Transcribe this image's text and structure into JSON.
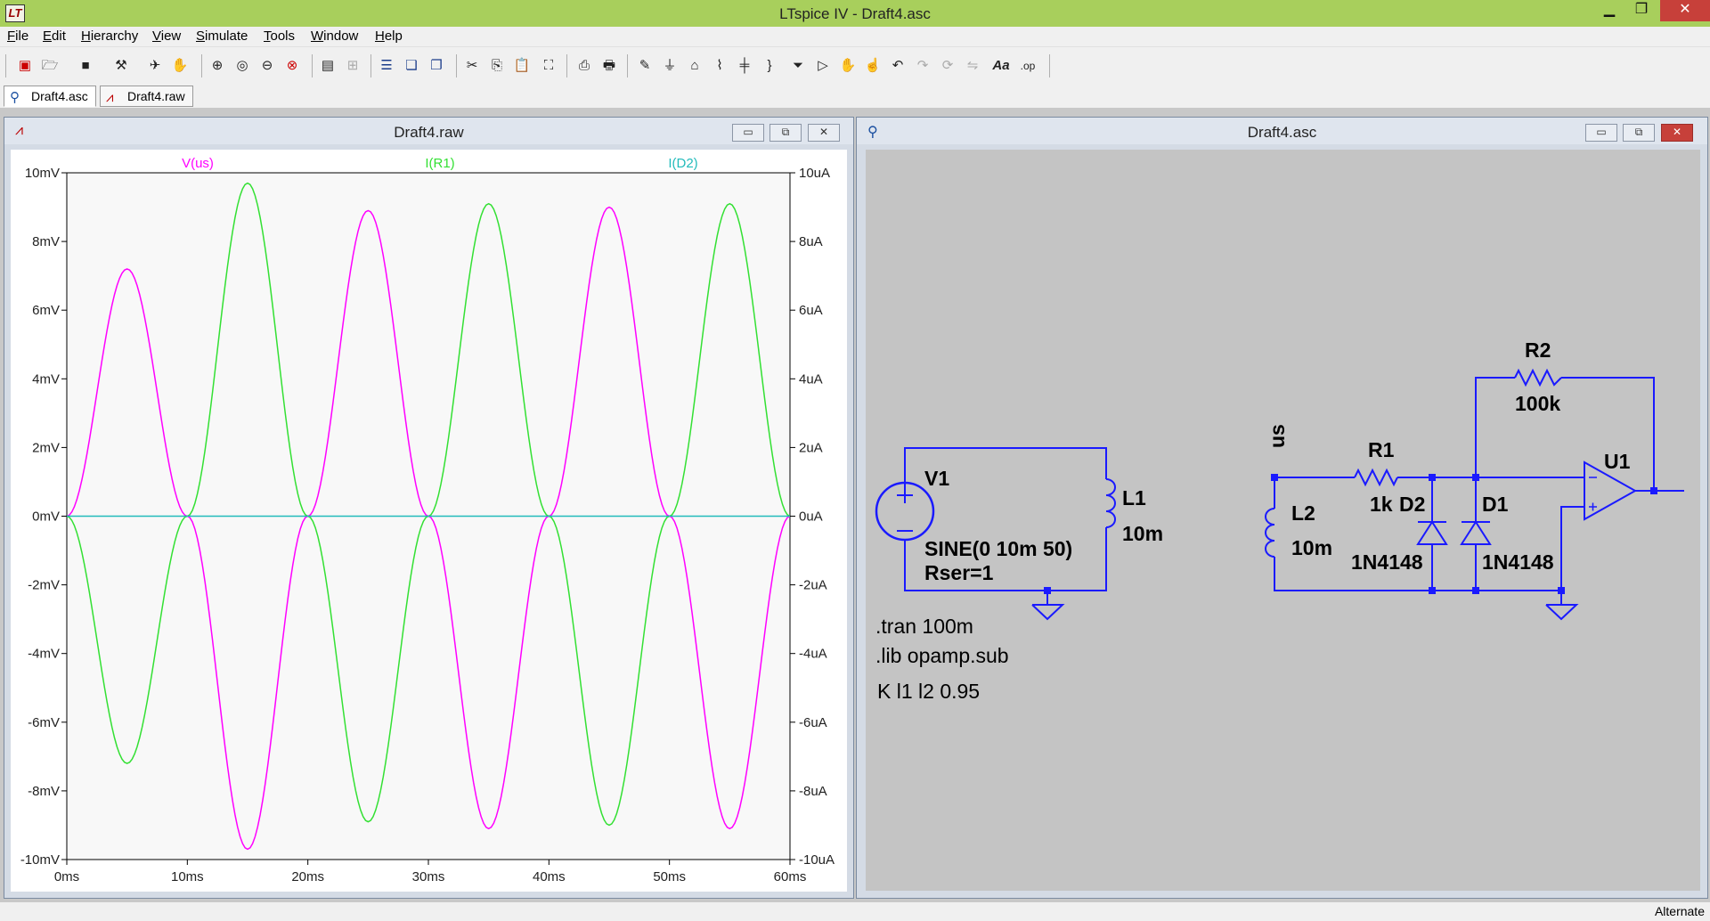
{
  "window": {
    "title": "LTspice IV - Draft4.asc",
    "logo": "LT"
  },
  "window_controls": {
    "minimize": "▁",
    "maximize": "❐",
    "close": "✕"
  },
  "menu": [
    {
      "label": "File",
      "acc": "F",
      "rest": "ile"
    },
    {
      "label": "Edit",
      "acc": "E",
      "rest": "dit"
    },
    {
      "label": "Hierarchy",
      "acc": "H",
      "rest": "ierarchy"
    },
    {
      "label": "View",
      "acc": "V",
      "rest": "iew"
    },
    {
      "label": "Simulate",
      "acc": "S",
      "rest": "imulate"
    },
    {
      "label": "Tools",
      "acc": "T",
      "rest": "ools"
    },
    {
      "label": "Window",
      "acc": "W",
      "rest": "indow"
    },
    {
      "label": "Help",
      "acc": "H",
      "rest": "elp"
    }
  ],
  "toolbar_icons": [
    "new-schematic-icon",
    "open-icon",
    "save-icon",
    "control-panel-icon",
    "run-icon",
    "halt-icon",
    "zoom-in-icon",
    "zoom-full-icon",
    "zoom-out-icon",
    "zoom-cancel-icon",
    "autorange-icon",
    "grid-icon",
    "tile-horizontal-icon",
    "cascade-icon",
    "tile-vertical-icon",
    "cut-icon",
    "copy-icon",
    "paste-icon",
    "find-icon",
    "print-setup-icon",
    "print-icon",
    "wire-icon",
    "ground-icon",
    "label-icon",
    "resistor-icon",
    "capacitor-icon",
    "inductor-icon",
    "diode-icon",
    "component-icon",
    "move-icon",
    "drag-icon",
    "undo-icon",
    "redo-icon",
    "rotate-icon",
    "mirror-icon",
    "text-icon",
    "spice-directive-icon"
  ],
  "tabs": [
    {
      "label": "Draft4.asc",
      "icon": "schematic-tab-icon",
      "active": true
    },
    {
      "label": "Draft4.raw",
      "icon": "waveform-tab-icon",
      "active": false
    }
  ],
  "waveform_window": {
    "title": "Draft4.raw",
    "buttons": {
      "minimize": "▭",
      "restore": "⧉",
      "close": "✕"
    }
  },
  "schematic_window": {
    "title": "Draft4.asc",
    "buttons": {
      "minimize": "▭",
      "restore": "⧉",
      "close": "✕"
    }
  },
  "chart_data": {
    "type": "line",
    "title": "",
    "xlabel": "",
    "ylabel": "",
    "y2label": "",
    "xlim": [
      0,
      60
    ],
    "x_unit": "ms",
    "ylim": [
      -10,
      10
    ],
    "y2lim": [
      -10,
      10
    ],
    "x_ticks": [
      "0ms",
      "10ms",
      "20ms",
      "30ms",
      "40ms",
      "50ms",
      "60ms"
    ],
    "y_ticks_left": [
      "10mV",
      "8mV",
      "6mV",
      "4mV",
      "2mV",
      "0mV",
      "-2mV",
      "-4mV",
      "-6mV",
      "-8mV",
      "-10mV"
    ],
    "y_ticks_right": [
      "10uA",
      "8uA",
      "6uA",
      "4uA",
      "2uA",
      "0uA",
      "-2uA",
      "-4uA",
      "-6uA",
      "-8uA",
      "-10uA"
    ],
    "grid": false,
    "series": [
      {
        "name": "V(us)",
        "color": "#ff00ff",
        "axis": "left",
        "x": [
          0,
          5,
          10,
          15,
          20,
          25,
          30,
          35,
          40,
          45,
          50,
          55,
          60
        ],
        "y": [
          0,
          7.2,
          0,
          -9.7,
          0,
          8.9,
          0,
          -9.1,
          0,
          9.0,
          0,
          -9.1,
          0
        ]
      },
      {
        "name": "I(R1)",
        "color": "#33e033",
        "axis": "right",
        "x": [
          0,
          5,
          10,
          15,
          20,
          25,
          30,
          35,
          40,
          45,
          50,
          55,
          60
        ],
        "y": [
          0,
          -7.2,
          0,
          9.7,
          0,
          -8.9,
          0,
          9.1,
          0,
          -9.0,
          0,
          9.1,
          0
        ]
      },
      {
        "name": "I(D2)",
        "color": "#22bbbb",
        "axis": "right",
        "x": [
          0,
          60
        ],
        "y": [
          0,
          0
        ]
      }
    ]
  },
  "schematic": {
    "labels": {
      "v1": "V1",
      "v1_spec": "SINE(0 10m 50)",
      "v1_rser": "Rser=1",
      "l1": "L1",
      "l1_val": "10m",
      "l2": "L2",
      "l2_val": "10m",
      "r1": "R1",
      "r1_val": "1k",
      "r2": "R2",
      "r2_val": "100k",
      "d1": "D1",
      "d1_val": "1N4148",
      "d2": "D2",
      "d2_val": "1N4148",
      "u1": "U1",
      "net_us": "us"
    },
    "directives": [
      ".tran 100m",
      ".lib opamp.sub",
      "K l1 l2 0.95"
    ]
  },
  "status": {
    "text": "Alternate"
  }
}
